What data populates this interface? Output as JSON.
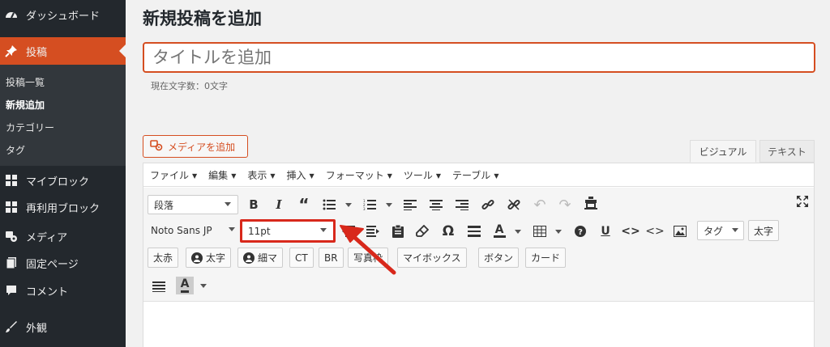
{
  "sidebar": {
    "items": [
      {
        "label": "ダッシュボード",
        "icon": "dashboard-icon"
      },
      {
        "label": "投稿",
        "icon": "pin-icon",
        "active": true
      },
      {
        "label": "マイブロック",
        "icon": "grid-icon"
      },
      {
        "label": "再利用ブロック",
        "icon": "grid-icon"
      },
      {
        "label": "メディア",
        "icon": "media-icon"
      },
      {
        "label": "固定ページ",
        "icon": "page-icon"
      },
      {
        "label": "コメント",
        "icon": "comment-icon"
      },
      {
        "label": "外観",
        "icon": "brush-icon"
      }
    ],
    "submenu": [
      {
        "label": "投稿一覧"
      },
      {
        "label": "新規追加",
        "current": true
      },
      {
        "label": "カテゴリー"
      },
      {
        "label": "タグ"
      }
    ]
  },
  "page": {
    "title": "新規投稿を追加",
    "title_placeholder": "タイトルを追加",
    "char_count": "現在文字数：0文字"
  },
  "editor": {
    "media_button": "メディアを追加",
    "tabs": {
      "visual": "ビジュアル",
      "text": "テキスト"
    },
    "menubar": [
      "ファイル",
      "編集",
      "表示",
      "挿入",
      "フォーマット",
      "ツール",
      "テーブル"
    ],
    "format_select": "段落",
    "font_select": "Noto Sans JP",
    "size_select": "11pt",
    "tag_select": "タグ",
    "bold_jp": "太字",
    "quick_buttons": [
      "太赤",
      "太字",
      "細マ",
      "CT",
      "BR",
      "写真枠",
      "マイボックス",
      "ボタン",
      "カード"
    ]
  },
  "colors": {
    "accent": "#d54e21",
    "sidebar_bg": "#23282d",
    "submenu_bg": "#32373c",
    "highlight": "#d8281b"
  }
}
